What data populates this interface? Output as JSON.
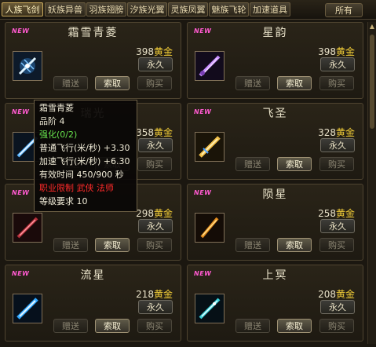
{
  "tabs": [
    {
      "label": "人族飞剑",
      "active": true
    },
    {
      "label": "妖族异兽",
      "active": false
    },
    {
      "label": "羽族翅膀",
      "active": false
    },
    {
      "label": "汐族光翼",
      "active": false
    },
    {
      "label": "灵族凤翼",
      "active": false
    },
    {
      "label": "魅族飞轮",
      "active": false
    },
    {
      "label": "加速道具",
      "active": false
    }
  ],
  "tab_all": "所有",
  "common": {
    "unit": "黄金",
    "permanent": "永久",
    "gift": "赠送",
    "claim": "索取",
    "buy": "购买",
    "new_badge": "NEW"
  },
  "items": [
    {
      "name": "霜雪青菱",
      "price": "398",
      "icon": "frost-sword-icon"
    },
    {
      "name": "星韵",
      "price": "398",
      "icon": "purple-blade-icon"
    },
    {
      "name": "瑞光",
      "price": "358",
      "icon": "blue-sword-icon"
    },
    {
      "name": "飞圣",
      "price": "328",
      "icon": "golden-sword-icon"
    },
    {
      "name": "",
      "price": "298",
      "icon": "crimson-sword-icon"
    },
    {
      "name": "陨星",
      "price": "258",
      "icon": "flame-sword-icon"
    },
    {
      "name": "流星",
      "price": "218",
      "icon": "comet-sword-icon"
    },
    {
      "name": "上冥",
      "price": "208",
      "icon": "azure-sword-icon"
    }
  ],
  "tooltip": {
    "title": "霜雪青菱",
    "grade": "品阶 4",
    "enhance": "强化(0/2)",
    "normal_speed": "普通飞行(米/秒) +3.30",
    "boost_speed": "加速飞行(米/秒) +6.30",
    "duration": "有效时间 450/900 秒",
    "job_limit": "职业限制 武侠 法师",
    "level_req": "等级要求 10"
  },
  "colors": {
    "gold": "#f4cf38",
    "new": "#ff5ad0",
    "enhance": "#66e04c",
    "restriction": "#ff2a2a"
  }
}
